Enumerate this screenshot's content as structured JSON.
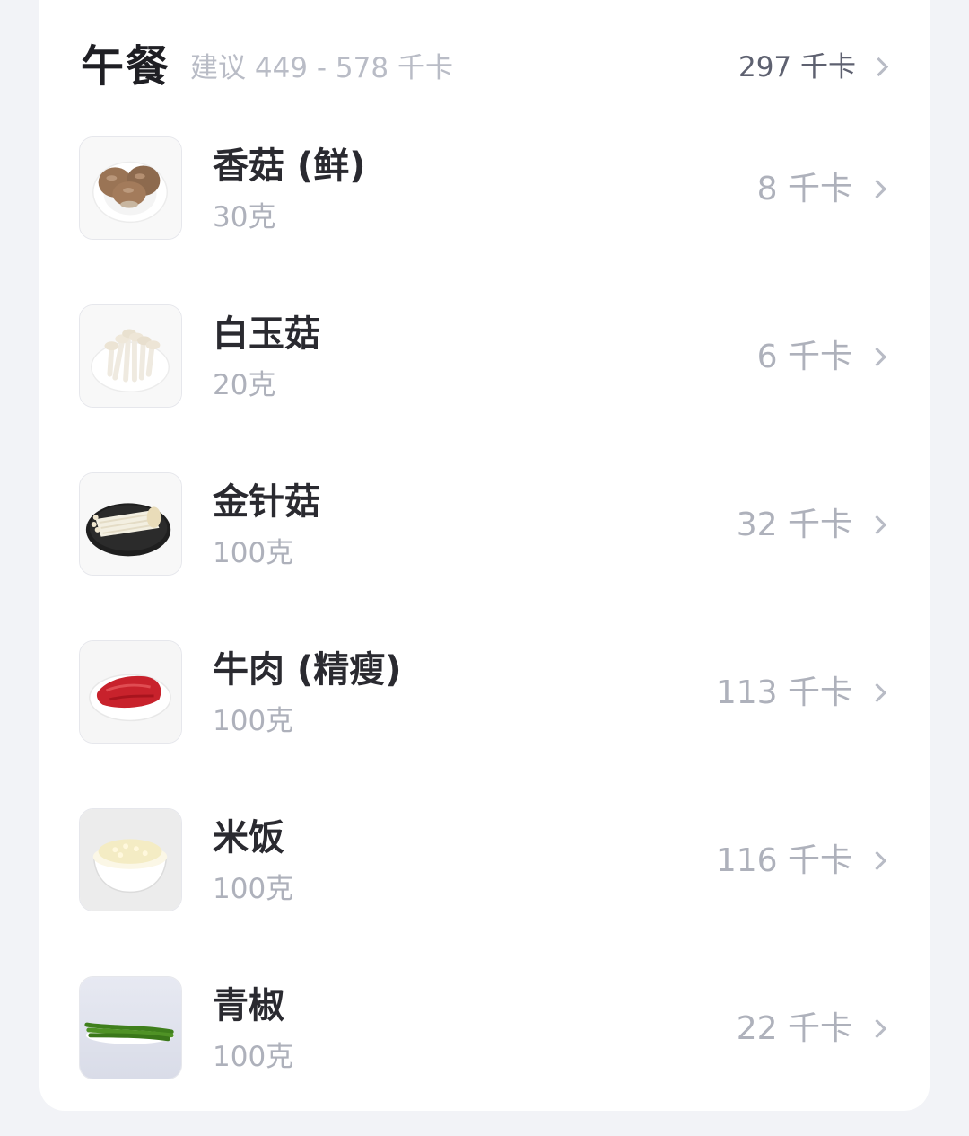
{
  "meal": {
    "title": "午餐",
    "suggestion": "建议 449 - 578 千卡",
    "total": "297 千卡"
  },
  "foods": [
    {
      "name": "香菇 (鲜)",
      "amount": "30克",
      "kcal": "8 千卡",
      "icon": "shiitake-mushroom-photo"
    },
    {
      "name": "白玉菇",
      "amount": "20克",
      "kcal": "6 千卡",
      "icon": "white-beech-mushroom-photo"
    },
    {
      "name": "金针菇",
      "amount": "100克",
      "kcal": "32 千卡",
      "icon": "enoki-mushroom-photo"
    },
    {
      "name": "牛肉 (精瘦)",
      "amount": "100克",
      "kcal": "113 千卡",
      "icon": "lean-beef-photo"
    },
    {
      "name": "米饭",
      "amount": "100克",
      "kcal": "116 千卡",
      "icon": "rice-bowl-photo"
    },
    {
      "name": "青椒",
      "amount": "100克",
      "kcal": "22 千卡",
      "icon": "green-pepper-photo"
    }
  ]
}
